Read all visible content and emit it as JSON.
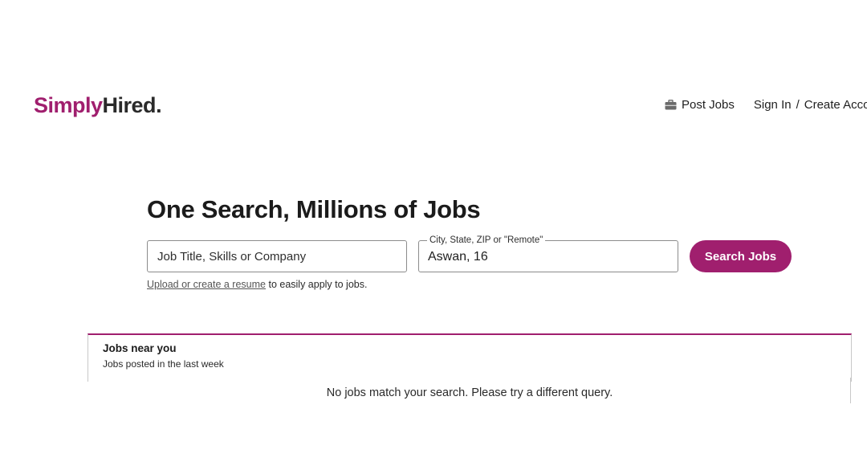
{
  "header": {
    "logo_part1": "Simply",
    "logo_part2": "Hired",
    "logo_dot": ".",
    "nav": {
      "post_jobs": "Post Jobs",
      "sign_in": "Sign In",
      "slash": "/",
      "create_account": "Create Accoun"
    },
    "icons": {
      "post_jobs": "briefcase-icon"
    }
  },
  "hero": {
    "title": "One Search, Millions of Jobs",
    "what_placeholder": "Job Title, Skills or Company",
    "where_label": "City, State, ZIP or \"Remote\"",
    "where_value": "Aswan, 16",
    "search_button": "Search Jobs",
    "resume_link": "Upload or create a resume",
    "resume_suffix": " to easily apply to jobs."
  },
  "jobs_near": {
    "title": "Jobs near you",
    "subtitle": "Jobs posted in the last week",
    "empty_message": "No jobs match your search. Please try a different query."
  },
  "colors": {
    "brand": "#a01f6e",
    "text": "#1f1f1f",
    "border": "#8c8c8c"
  }
}
